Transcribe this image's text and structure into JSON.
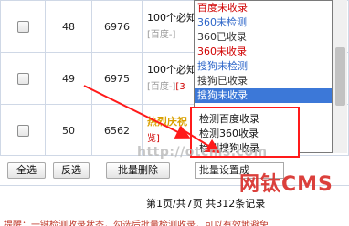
{
  "table": {
    "rows": [
      {
        "seq": "48",
        "id": "6976",
        "title": "100个必知",
        "sub_prefix": "[百度-]",
        "sub_red": "",
        "hot": false
      },
      {
        "seq": "49",
        "id": "6975",
        "title": "100个必知",
        "sub_prefix": "[百度-]",
        "sub_red": "[3",
        "hot": false
      },
      {
        "seq": "50",
        "id": "6562",
        "title": "热烈庆祝",
        "sub_prefix": "览]",
        "sub_red": "",
        "hot": true
      }
    ]
  },
  "dropdown": {
    "options": [
      {
        "label": "百度未收录",
        "color": "red"
      },
      {
        "label": "360未检测",
        "color": "blue"
      },
      {
        "label": "360已收录",
        "color": "dark"
      },
      {
        "label": "360未收录",
        "color": "red"
      },
      {
        "label": "搜狗未检测",
        "color": "blue"
      },
      {
        "label": "搜狗已收录",
        "color": "dark"
      },
      {
        "label": "搜狗未收录",
        "color": "selected"
      }
    ]
  },
  "highlight": {
    "items": [
      "检测百度收录",
      "检测360收录",
      "检测搜狗收录"
    ]
  },
  "toolbar": {
    "select_all": "全选",
    "invert": "反选",
    "batch_delete": "批量删除",
    "batch_select": "批量设置成"
  },
  "pager": {
    "text": "第1页/共7页  共312条记录"
  },
  "footer": {
    "text": "提醒：一键检测收录状态，勾选后批量检测收录，可以有效地避免"
  },
  "watermark": {
    "logo": "网钛CMS",
    "url": "http://otcms.com"
  },
  "colors": {
    "accent_red": "#ff1a1a",
    "selected_blue": "#3c78d8",
    "link_blue": "#2b64c8"
  }
}
